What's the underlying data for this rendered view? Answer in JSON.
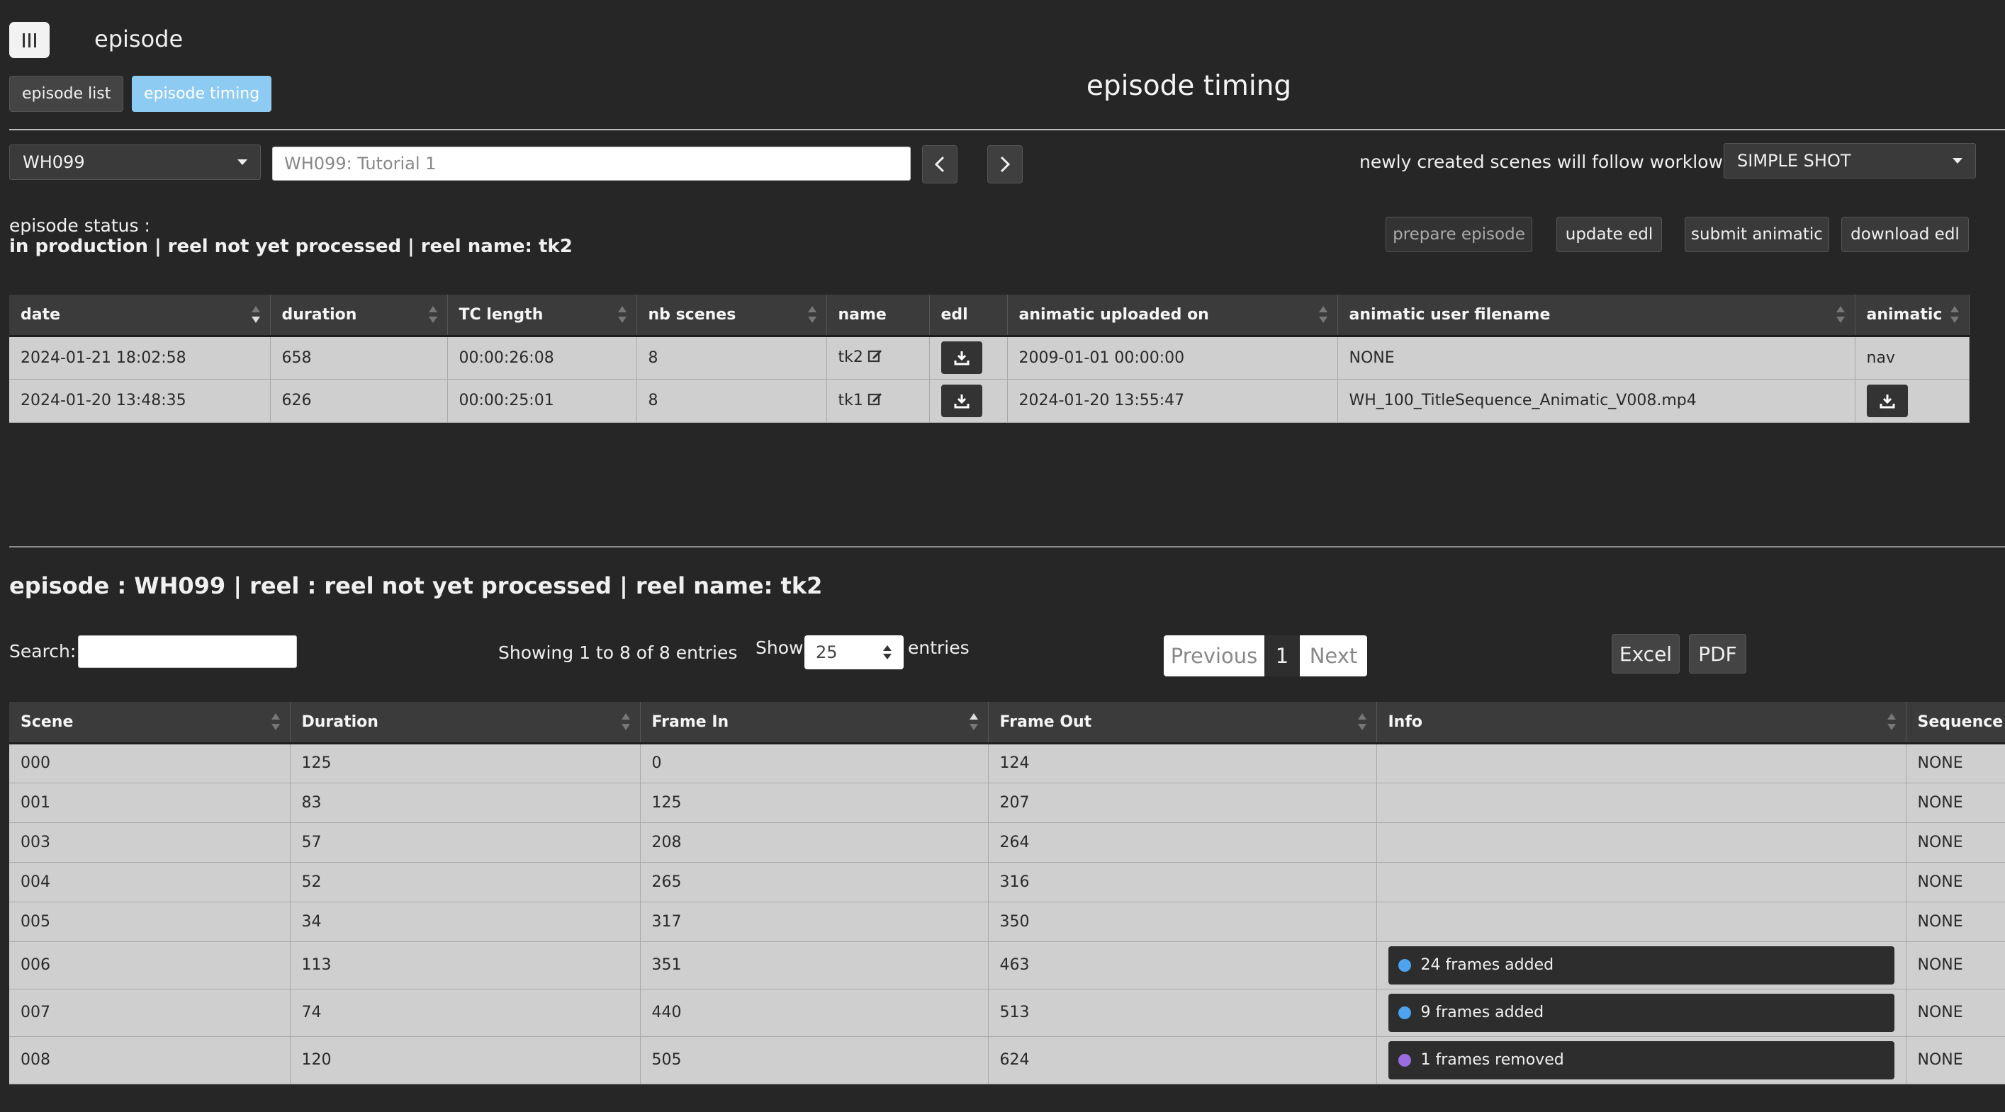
{
  "header": {
    "app_title": "episode",
    "page_title": "episode timing",
    "nav": {
      "episode_list": "episode list",
      "episode_timing": "episode timing"
    }
  },
  "controls": {
    "episode_select": "WH099",
    "episode_name": "WH099: Tutorial 1",
    "workflow_label": "newly created scenes will follow worklow:",
    "workflow_select": "SIMPLE SHOT"
  },
  "status": {
    "label": "episode status :",
    "value": "in production | reel not yet processed | reel name: tk2"
  },
  "actions": {
    "prepare": "prepare episode",
    "update_edl": "update edl",
    "submit_animatic": "submit animatic",
    "download_edl": "download edl"
  },
  "reels": {
    "columns": [
      "date",
      "duration",
      "TC length",
      "nb scenes",
      "name",
      "edl",
      "animatic uploaded on",
      "animatic user filename",
      "animatic"
    ],
    "rows": [
      {
        "date": "2024-01-21 18:02:58",
        "duration": "658",
        "tc": "00:00:26:08",
        "nb": "8",
        "name": "tk2",
        "uploaded": "2009-01-01 00:00:00",
        "filename": "NONE",
        "animatic": "nav"
      },
      {
        "date": "2024-01-20 13:48:35",
        "duration": "626",
        "tc": "00:00:25:01",
        "nb": "8",
        "name": "tk1",
        "uploaded": "2024-01-20 13:55:47",
        "filename": "WH_100_TitleSequence_Animatic_V008.mp4",
        "animatic": ""
      }
    ]
  },
  "scenes_section": {
    "title": "episode : WH099 | reel : reel not yet processed | reel name: tk2",
    "search_label": "Search:",
    "showing": "Showing 1 to 8 of 8 entries",
    "show_label": "Show",
    "page_length": "25",
    "entries_label": "entries",
    "prev": "Previous",
    "page": "1",
    "next": "Next",
    "excel": "Excel",
    "pdf": "PDF"
  },
  "scenes": {
    "columns": [
      "Scene",
      "Duration",
      "Frame In",
      "Frame Out",
      "Info",
      "Sequence"
    ],
    "rows": [
      {
        "scene": "000",
        "duration": "125",
        "in": "0",
        "out": "124",
        "info": "",
        "info_color": "",
        "seq": "NONE"
      },
      {
        "scene": "001",
        "duration": "83",
        "in": "125",
        "out": "207",
        "info": "",
        "info_color": "",
        "seq": "NONE"
      },
      {
        "scene": "003",
        "duration": "57",
        "in": "208",
        "out": "264",
        "info": "",
        "info_color": "",
        "seq": "NONE"
      },
      {
        "scene": "004",
        "duration": "52",
        "in": "265",
        "out": "316",
        "info": "",
        "info_color": "",
        "seq": "NONE"
      },
      {
        "scene": "005",
        "duration": "34",
        "in": "317",
        "out": "350",
        "info": "",
        "info_color": "",
        "seq": "NONE"
      },
      {
        "scene": "006",
        "duration": "113",
        "in": "351",
        "out": "463",
        "info": "24 frames added",
        "info_color": "#4da3f0",
        "seq": "NONE"
      },
      {
        "scene": "007",
        "duration": "74",
        "in": "440",
        "out": "513",
        "info": "9 frames added",
        "info_color": "#4da3f0",
        "seq": "NONE"
      },
      {
        "scene": "008",
        "duration": "120",
        "in": "505",
        "out": "624",
        "info": "1 frames removed",
        "info_color": "#9a6ee0",
        "seq": "NONE"
      }
    ]
  }
}
